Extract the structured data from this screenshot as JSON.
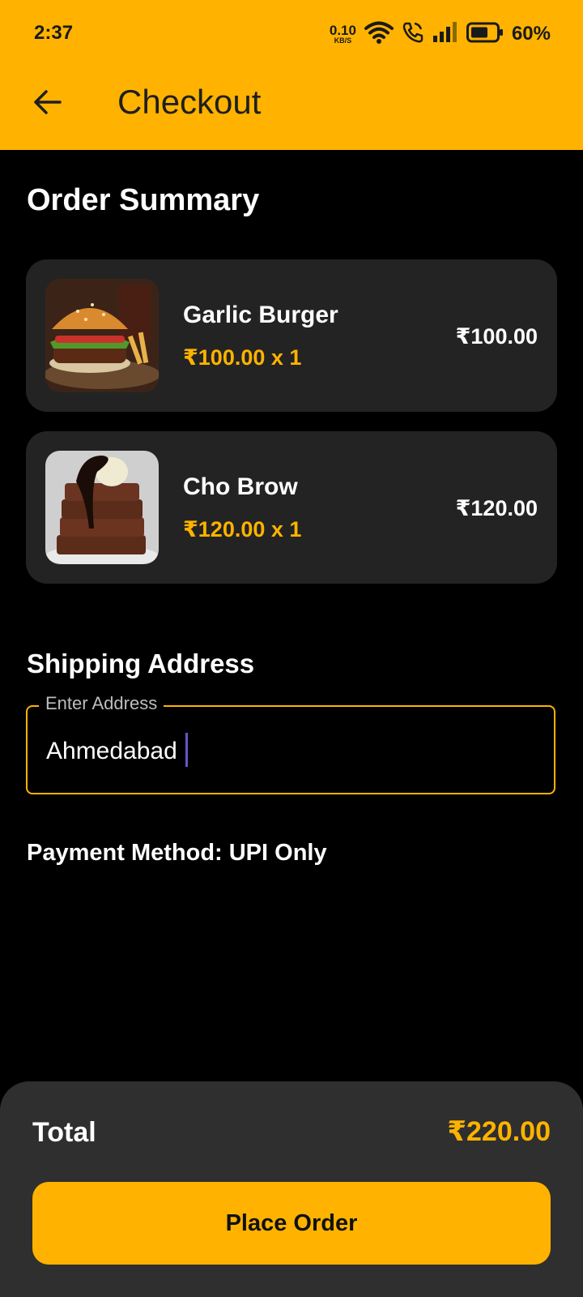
{
  "status_bar": {
    "time": "2:37",
    "net_speed": "0.10",
    "net_unit": "KB/S",
    "battery": "60%",
    "icons": [
      "wifi-icon",
      "volte-call-icon",
      "signal-icon",
      "battery-icon"
    ]
  },
  "app_bar": {
    "title": "Checkout",
    "back_icon": "arrow-back-icon",
    "color": "#FFB300"
  },
  "order_summary": {
    "title": "Order Summary",
    "items": [
      {
        "name": "Garlic Burger",
        "unit_line": "₹100.00 x 1",
        "price": "₹100.00",
        "image": "burger-photo"
      },
      {
        "name": "Cho Brow",
        "unit_line": "₹120.00 x 1",
        "price": "₹120.00",
        "image": "brownie-photo"
      }
    ]
  },
  "shipping": {
    "title": "Shipping Address",
    "field_label": "Enter Address",
    "value": "Ahmedabad"
  },
  "payment": {
    "text": "Payment Method: UPI Only"
  },
  "footer": {
    "total_label": "Total",
    "total_value": "₹220.00",
    "button_label": "Place Order"
  },
  "colors": {
    "accent": "#FFB300",
    "background": "#000000",
    "card": "#232323",
    "footer": "#2f2f2f"
  }
}
